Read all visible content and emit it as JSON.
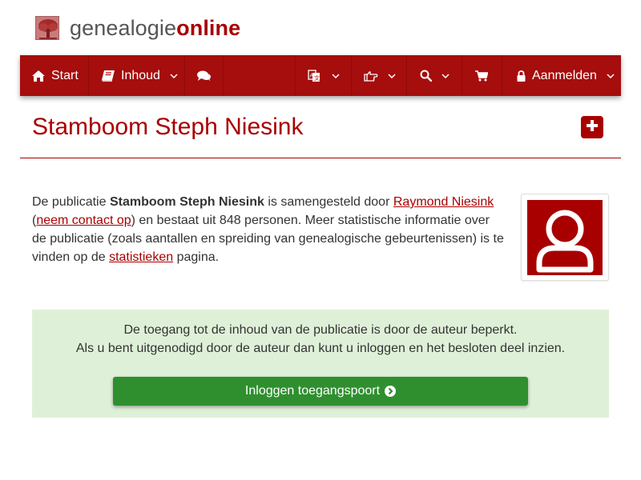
{
  "brand": {
    "name_plain": "genealogie",
    "name_strong": "online",
    "logo_icon": "tree-icon"
  },
  "navbar": {
    "start_label": "Start",
    "start_icon": "home-icon",
    "inhoud_label": "Inhoud",
    "inhoud_icon": "book-icon",
    "chat_icon": "comments-icon",
    "language_icon": "translate-icon",
    "hand_icon": "hand-pointer-icon",
    "search_icon": "search-icon",
    "cart_icon": "shopping-cart-icon",
    "login_label": "Aanmelden",
    "login_icon": "lock-icon"
  },
  "page": {
    "title": "Stamboom Steph Niesink",
    "add_icon": "plus-square-icon"
  },
  "intro": {
    "t1": "De publicatie ",
    "pub_name": "Stamboom Steph Niesink",
    "t2": " is samengesteld door ",
    "author": "Raymond Niesink",
    "t3": "(",
    "contact": "neem contact op",
    "t4": ") en bestaat uit 848 personen. Meer statistische informatie over de publicatie (zoals aantallen en spreiding van genealogische gebeurtenissen) is te vinden op de ",
    "stats": "statistieken",
    "t5": " pagina.",
    "avatar_icon": "user-icon"
  },
  "notice": {
    "line1": "De toegang tot de inhoud van de publicatie is door de auteur beperkt.",
    "line2": "Als u bent uitgenodigd door de auteur dan kunt u inloggen en het besloten deel inzien.",
    "button_label": "Inloggen toegangspoort",
    "button_icon": "chevron-circle-right-icon"
  },
  "colors": {
    "brand_red": "#a80000",
    "nav_red": "#a60d0d",
    "notice_green_bg": "#dff0d8",
    "button_green": "#2f8f2f"
  }
}
